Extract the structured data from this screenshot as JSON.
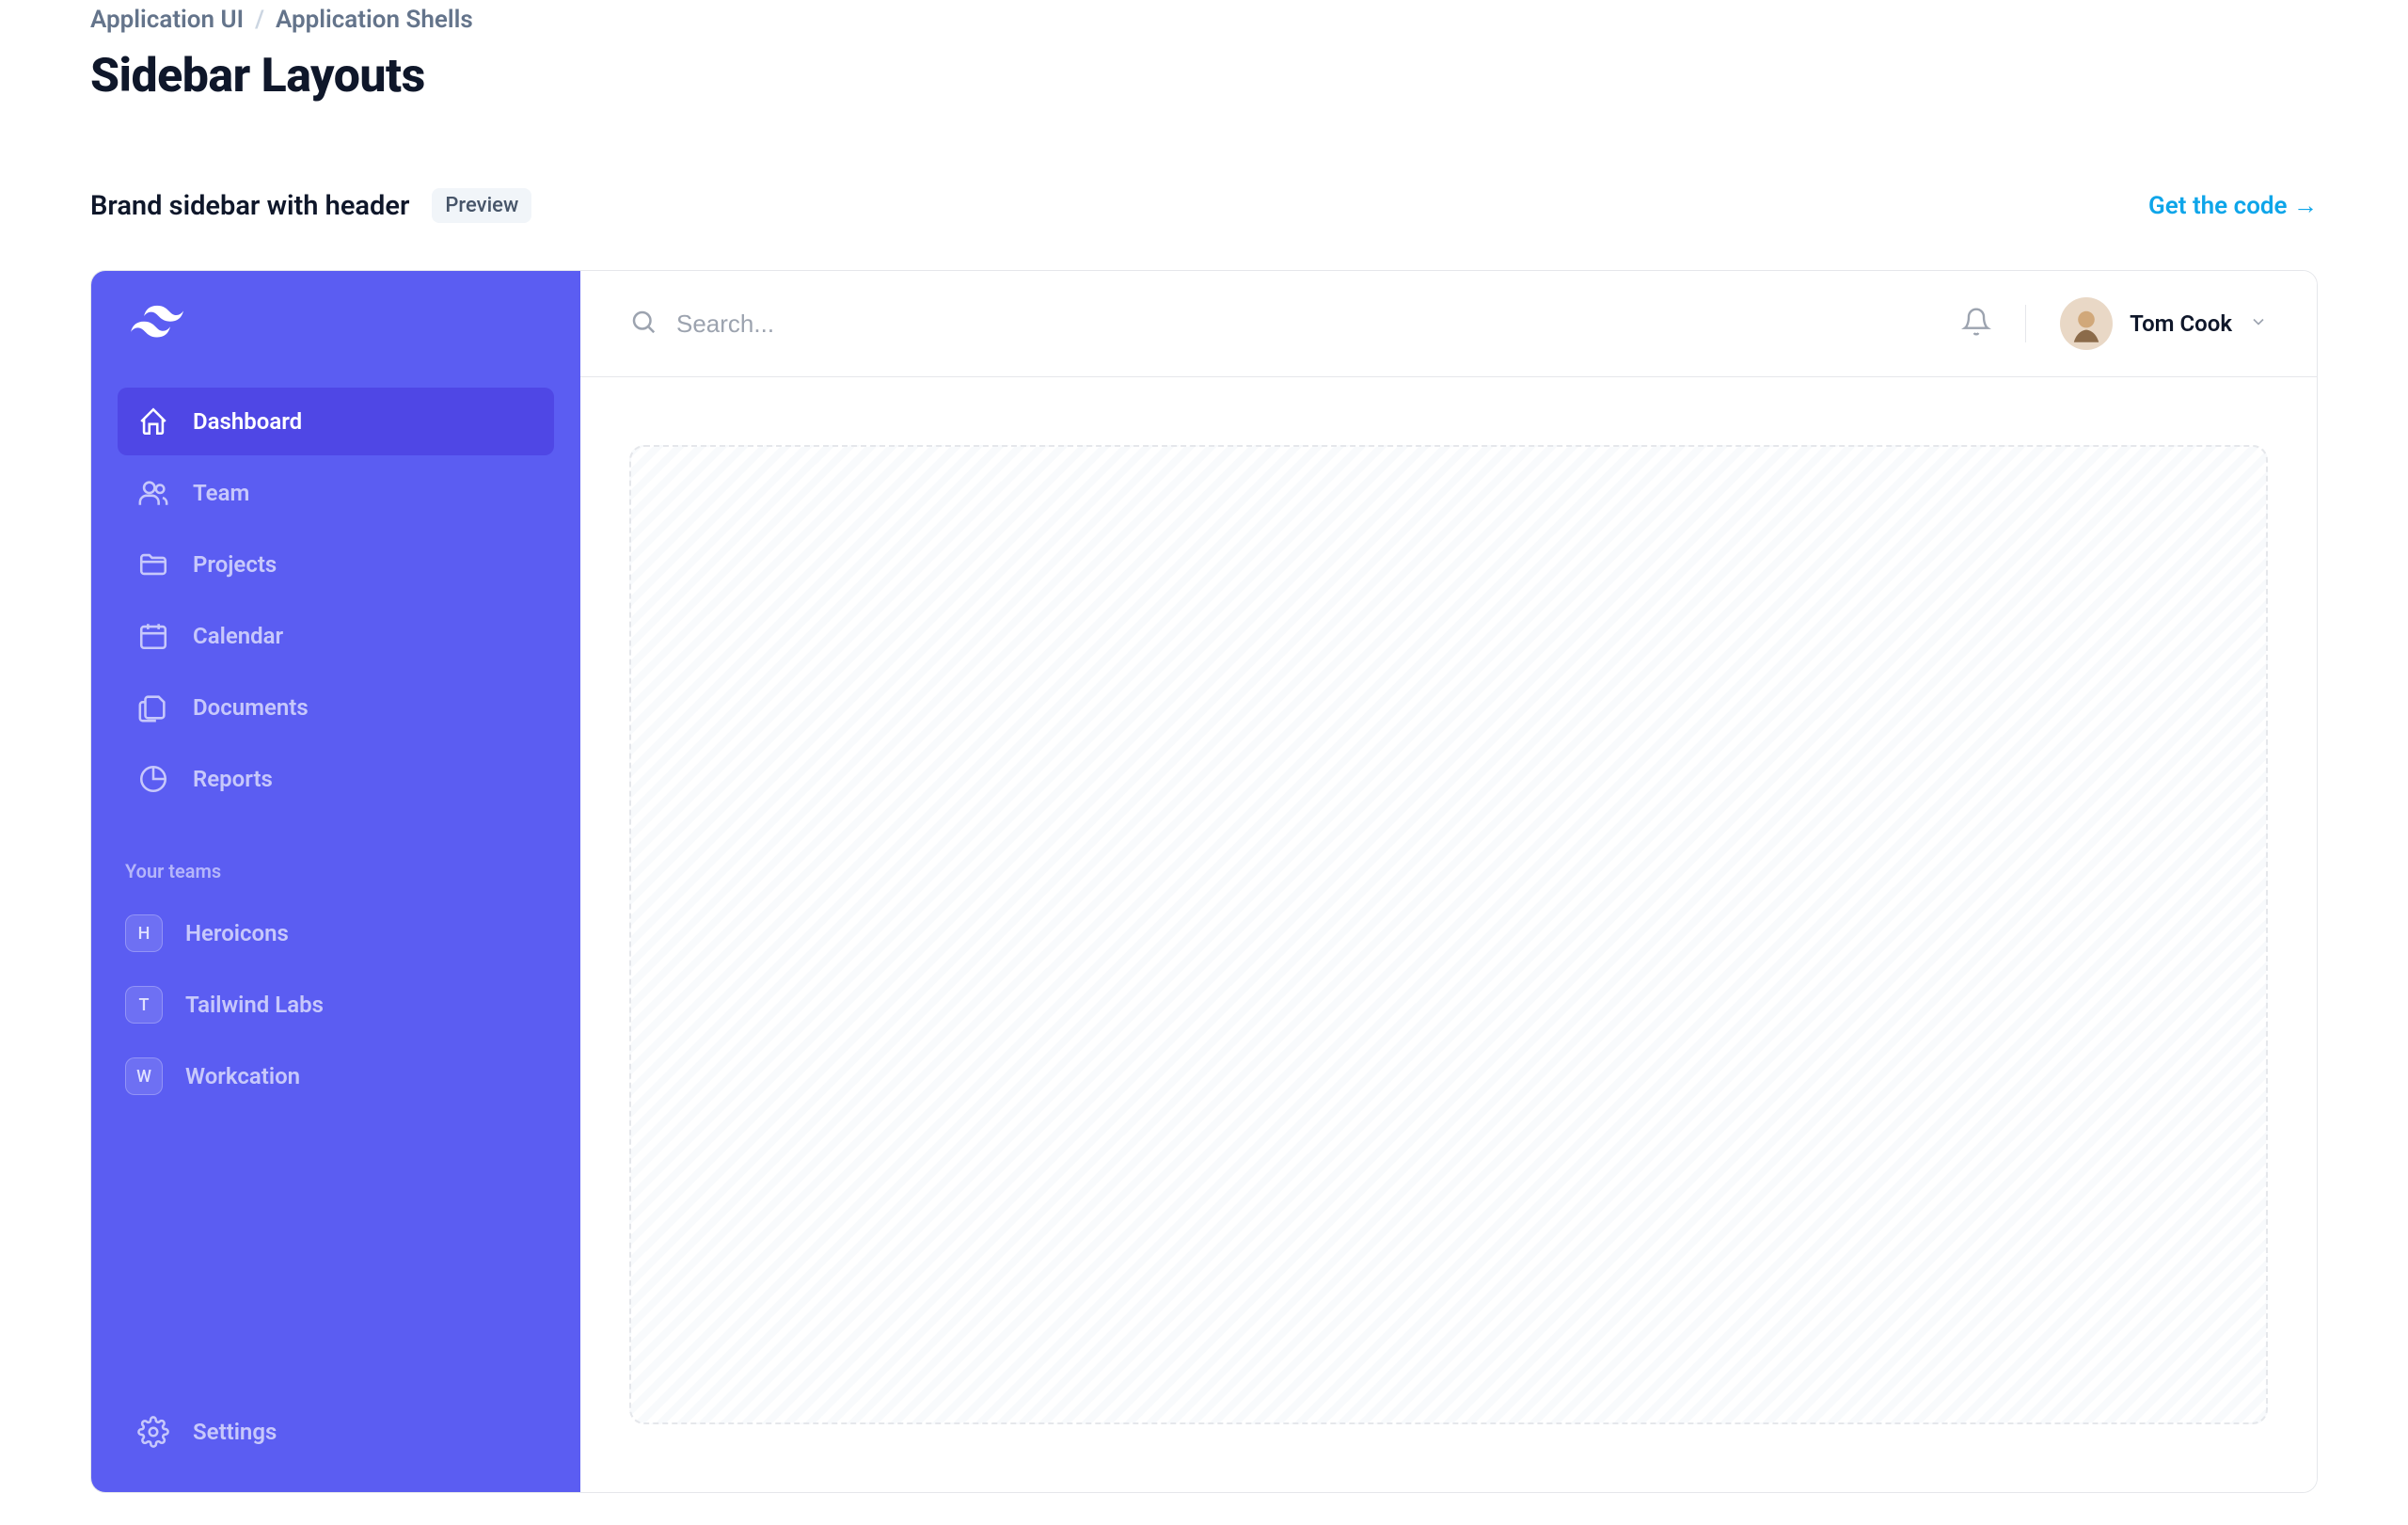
{
  "breadcrumb": {
    "item1": "Application UI",
    "item2": "Application Shells"
  },
  "page_title": "Sidebar Layouts",
  "section": {
    "title": "Brand sidebar with header",
    "badge": "Preview",
    "link": "Get the code →"
  },
  "sidebar": {
    "nav": [
      {
        "label": "Dashboard",
        "icon": "home-icon",
        "active": true
      },
      {
        "label": "Team",
        "icon": "users-icon",
        "active": false
      },
      {
        "label": "Projects",
        "icon": "folder-icon",
        "active": false
      },
      {
        "label": "Calendar",
        "icon": "calendar-icon",
        "active": false
      },
      {
        "label": "Documents",
        "icon": "documents-icon",
        "active": false
      },
      {
        "label": "Reports",
        "icon": "chart-pie-icon",
        "active": false
      }
    ],
    "teams_label": "Your teams",
    "teams": [
      {
        "letter": "H",
        "label": "Heroicons"
      },
      {
        "letter": "T",
        "label": "Tailwind Labs"
      },
      {
        "letter": "W",
        "label": "Workcation"
      }
    ],
    "settings_label": "Settings"
  },
  "topbar": {
    "search_placeholder": "Search...",
    "username": "Tom Cook"
  }
}
